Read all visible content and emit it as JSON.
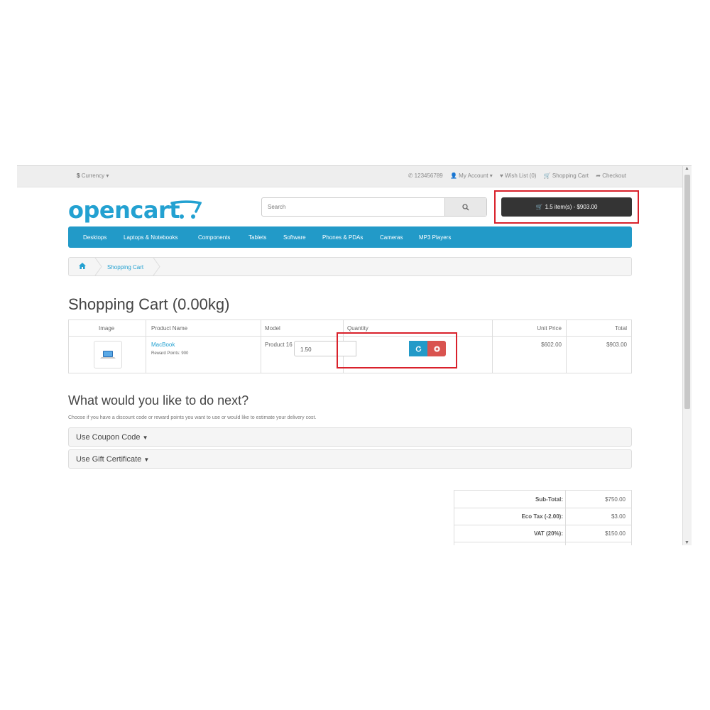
{
  "topbar": {
    "currency_label": "Currency",
    "phone": "123456789",
    "my_account": "My Account",
    "wish_list": "Wish List (0)",
    "shopping_cart": "Shopping Cart",
    "checkout": "Checkout"
  },
  "header": {
    "logo_text": "opencart",
    "search_placeholder": "Search",
    "cart_button_label": "1.5 item(s) - $903.00"
  },
  "nav": {
    "items": [
      "Desktops",
      "Laptops & Notebooks",
      "Components",
      "Tablets",
      "Software",
      "Phones & PDAs",
      "Cameras",
      "MP3 Players"
    ]
  },
  "breadcrumb": {
    "current": "Shopping Cart"
  },
  "page": {
    "title": "Shopping Cart  (0.00kg)"
  },
  "cart_table": {
    "headers": {
      "image": "Image",
      "product_name": "Product Name",
      "model": "Model",
      "quantity": "Quantity",
      "unit_price": "Unit Price",
      "total": "Total"
    },
    "rows": [
      {
        "product_name": "MacBook",
        "reward_points": "Reward Points: 900",
        "model": "Product 16",
        "quantity": "1.50",
        "unit_price": "$602.00",
        "total": "$903.00"
      }
    ]
  },
  "next_section": {
    "heading": "What would you like to do next?",
    "description": "Choose if you have a discount code or reward points you want to use or would like to estimate your delivery cost.",
    "panels": [
      "Use Coupon Code",
      "Use Gift Certificate"
    ]
  },
  "totals": [
    {
      "label": "Sub-Total:",
      "value": "$750.00"
    },
    {
      "label": "Eco Tax (-2.00):",
      "value": "$3.00"
    },
    {
      "label": "VAT (20%):",
      "value": "$150.00"
    }
  ],
  "colors": {
    "brand_blue": "#229ac8",
    "link_blue": "#23a1d1",
    "dark_button": "#343434",
    "highlight_red": "#d9212b",
    "refresh_button": "#229ac8",
    "remove_button": "#d9534f"
  }
}
